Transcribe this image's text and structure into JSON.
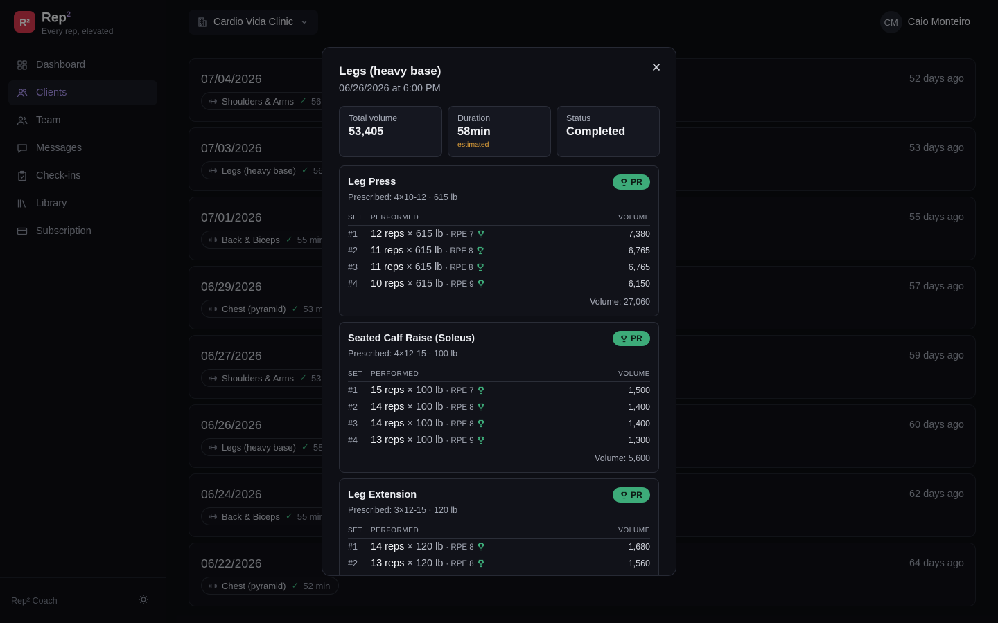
{
  "brand": {
    "name": "Rep",
    "superscript": "2",
    "logo_text": "R²",
    "tagline": "Every rep, elevated"
  },
  "nav": [
    {
      "label": "Dashboard",
      "icon": "dashboard-icon"
    },
    {
      "label": "Clients",
      "icon": "users-icon",
      "active": true
    },
    {
      "label": "Team",
      "icon": "team-icon"
    },
    {
      "label": "Messages",
      "icon": "message-icon"
    },
    {
      "label": "Check-ins",
      "icon": "clipboard-icon"
    },
    {
      "label": "Library",
      "icon": "library-icon"
    },
    {
      "label": "Subscription",
      "icon": "card-icon"
    }
  ],
  "sidebar_footer": {
    "label": "Rep² Coach"
  },
  "header": {
    "clinic": "Cardio Vida Clinic",
    "user_initials": "CM",
    "user_name": "Caio Monteiro"
  },
  "workouts": [
    {
      "date": "07/04/2026",
      "name": "Shoulders & Arms",
      "duration": "56",
      "ago": "52 days ago"
    },
    {
      "date": "07/03/2026",
      "name": "Legs (heavy base)",
      "duration": "56",
      "ago": "53 days ago"
    },
    {
      "date": "07/01/2026",
      "name": "Back & Biceps",
      "duration": "55 min",
      "ago": "55 days ago"
    },
    {
      "date": "06/29/2026",
      "name": "Chest (pyramid)",
      "duration": "53 m",
      "ago": "57 days ago"
    },
    {
      "date": "06/27/2026",
      "name": "Shoulders & Arms",
      "duration": "53",
      "ago": "59 days ago"
    },
    {
      "date": "06/26/2026",
      "name": "Legs (heavy base)",
      "duration": "58",
      "ago": "60 days ago"
    },
    {
      "date": "06/24/2026",
      "name": "Back & Biceps",
      "duration": "55 min",
      "ago": "62 days ago"
    },
    {
      "date": "06/22/2026",
      "name": "Chest (pyramid)",
      "duration": "52 min",
      "ago": "64 days ago"
    }
  ],
  "modal": {
    "title": "Legs (heavy base)",
    "subtitle": "06/26/2026 at 6:00 PM",
    "stats": [
      {
        "label": "Total volume",
        "value": "53,405",
        "note": ""
      },
      {
        "label": "Duration",
        "value": "58min",
        "note": "estimated"
      },
      {
        "label": "Status",
        "value": "Completed",
        "note": ""
      }
    ],
    "table_headers": {
      "set": "SET",
      "performed": "PERFORMED",
      "volume": "VOLUME"
    },
    "pr_label": "PR",
    "exercises": [
      {
        "name": "Leg Press",
        "prescribed": "Prescribed: 4×10-12 · 615 lb",
        "sets": [
          {
            "set": "#1",
            "reps": "12 reps",
            "weight": "× 615 lb",
            "rpe": "· RPE 7",
            "volume": "7,380"
          },
          {
            "set": "#2",
            "reps": "11 reps",
            "weight": "× 615 lb",
            "rpe": "· RPE 8",
            "volume": "6,765"
          },
          {
            "set": "#3",
            "reps": "11 reps",
            "weight": "× 615 lb",
            "rpe": "· RPE 8",
            "volume": "6,765"
          },
          {
            "set": "#4",
            "reps": "10 reps",
            "weight": "× 615 lb",
            "rpe": "· RPE 9",
            "volume": "6,150"
          }
        ],
        "total": "Volume: 27,060"
      },
      {
        "name": "Seated Calf Raise (Soleus)",
        "prescribed": "Prescribed: 4×12-15 · 100 lb",
        "sets": [
          {
            "set": "#1",
            "reps": "15 reps",
            "weight": "× 100 lb",
            "rpe": "· RPE 7",
            "volume": "1,500"
          },
          {
            "set": "#2",
            "reps": "14 reps",
            "weight": "× 100 lb",
            "rpe": "· RPE 8",
            "volume": "1,400"
          },
          {
            "set": "#3",
            "reps": "14 reps",
            "weight": "× 100 lb",
            "rpe": "· RPE 8",
            "volume": "1,400"
          },
          {
            "set": "#4",
            "reps": "13 reps",
            "weight": "× 100 lb",
            "rpe": "· RPE 9",
            "volume": "1,300"
          }
        ],
        "total": "Volume: 5,600"
      },
      {
        "name": "Leg Extension",
        "prescribed": "Prescribed: 3×12-15 · 120 lb",
        "sets": [
          {
            "set": "#1",
            "reps": "14 reps",
            "weight": "× 120 lb",
            "rpe": "· RPE 8",
            "volume": "1,680"
          },
          {
            "set": "#2",
            "reps": "13 reps",
            "weight": "× 120 lb",
            "rpe": "· RPE 8",
            "volume": "1,560"
          }
        ],
        "total": ""
      }
    ]
  },
  "colors": {
    "accent": "#a48ee6",
    "brand": "#d6384e",
    "success": "#3dab79",
    "warning": "#e0a13a"
  }
}
